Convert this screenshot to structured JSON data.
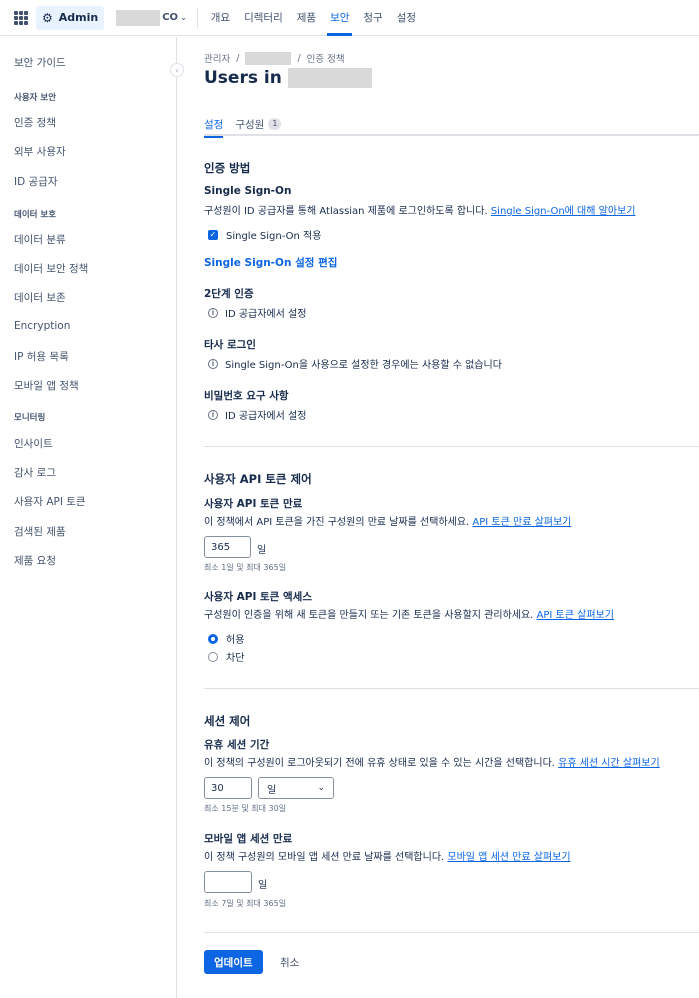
{
  "topbar": {
    "admin_label": "Admin",
    "org_suffix": "CO",
    "nav": [
      "개요",
      "디렉터리",
      "제품",
      "보안",
      "청구",
      "설정"
    ],
    "active_nav": "보안"
  },
  "sidebar": {
    "items": [
      {
        "type": "item",
        "label": "보안 가이드"
      },
      {
        "type": "head",
        "label": "사용자 보안"
      },
      {
        "type": "item",
        "label": "인증 정책"
      },
      {
        "type": "item",
        "label": "외부 사용자"
      },
      {
        "type": "item",
        "label": "ID 공급자"
      },
      {
        "type": "head",
        "label": "데이터 보호"
      },
      {
        "type": "item",
        "label": "데이터 분류"
      },
      {
        "type": "item",
        "label": "데이터 보안 정책"
      },
      {
        "type": "item",
        "label": "데이터 보존"
      },
      {
        "type": "item",
        "label": "Encryption"
      },
      {
        "type": "item",
        "label": "IP 허용 목록"
      },
      {
        "type": "item",
        "label": "모바일 앱 정책"
      },
      {
        "type": "head",
        "label": "모니터링"
      },
      {
        "type": "item",
        "label": "인사이트"
      },
      {
        "type": "item",
        "label": "감사 로그"
      },
      {
        "type": "item",
        "label": "사용자 API 토큰"
      },
      {
        "type": "item",
        "label": "검색된 제품"
      },
      {
        "type": "item",
        "label": "제품 요청"
      }
    ]
  },
  "breadcrumb": {
    "first": "관리자",
    "sep": "/",
    "last": "인증 정책"
  },
  "page_title": "Users in",
  "tabs": {
    "settings": "설정",
    "members": "구성원",
    "members_count": "1"
  },
  "auth": {
    "heading": "인증 방법",
    "sso_title": "Single Sign-On",
    "sso_desc": "구성원이 ID 공급자를 통해 Atlassian 제품에 로그인하도록 합니다.",
    "sso_link": "Single Sign-On에 대해 알아보기",
    "sso_checkbox": "Single Sign-On 적용",
    "sso_edit": "Single Sign-On 설정 편집",
    "twofa_title": "2단계 인증",
    "twofa_info": "ID 공급자에서 설정",
    "third_title": "타사 로그인",
    "third_info": "Single Sign-On을 사용으로 설정한 경우에는 사용할 수 없습니다",
    "pw_title": "비밀번호 요구 사항",
    "pw_info": "ID 공급자에서 설정"
  },
  "api": {
    "heading": "사용자 API 토큰 제어",
    "expiry_title": "사용자 API 토큰 만료",
    "expiry_desc": "이 정책에서 API 토큰을 가진 구성원의 만료 날짜를 선택하세요.",
    "expiry_link": "API 토큰 만료 살펴보기",
    "expiry_value": "365",
    "expiry_unit": "일",
    "expiry_help": "최소 1일 및 최대 365일",
    "access_title": "사용자 API 토큰 액세스",
    "access_desc": "구성원이 인증을 위해 새 토큰을 만들지 또는 기존 토큰을 사용할지 관리하세요.",
    "access_link": "API 토큰 살펴보기",
    "allow": "허용",
    "block": "차단",
    "selected": "허용"
  },
  "session": {
    "heading": "세션 제어",
    "idle_title": "유휴 세션 기간",
    "idle_desc": "이 정책의 구성원이 로그아웃되기 전에 유휴 상태로 있을 수 있는 시간을 선택합니다.",
    "idle_link": "유휴 세션 시간 살펴보기",
    "idle_value": "30",
    "idle_unit": "일",
    "idle_help": "최소 15분 및 최대 30일",
    "mobile_title": "모바일 앱 세션 만료",
    "mobile_desc": "이 정책 구성원의 모바일 앱 세션 만료 날짜를 선택합니다.",
    "mobile_link": "모바일 앱 세션 만료 살펴보기",
    "mobile_value": "",
    "mobile_unit": "일",
    "mobile_help": "최소 7일 및 최대 365일"
  },
  "actions": {
    "update": "업데이트",
    "cancel": "취소"
  },
  "colors": {
    "accent": "#0C66E4",
    "text": "#172B4D",
    "border": "#DFE1E6"
  }
}
